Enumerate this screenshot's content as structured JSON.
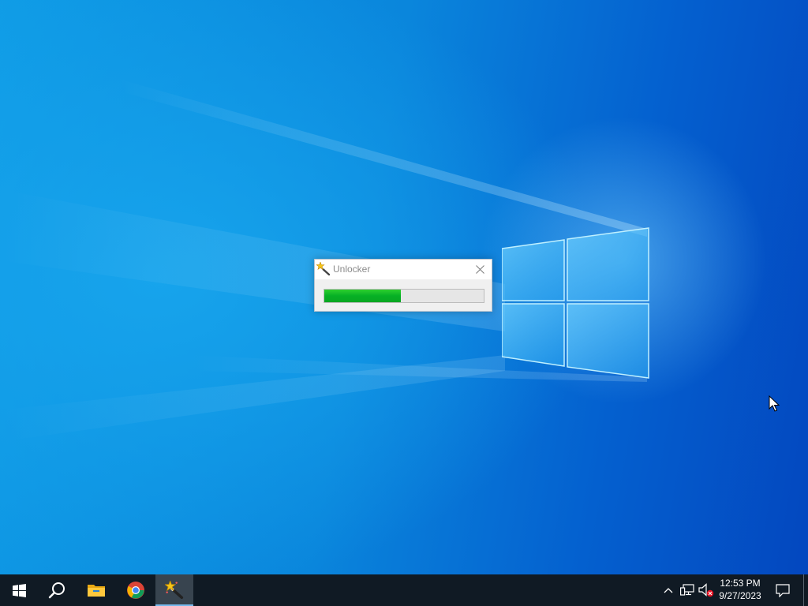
{
  "dialog": {
    "title": "Unlocker",
    "progress_fraction": 0.48,
    "icon": "magic-wand-icon",
    "close_icon": "close-icon"
  },
  "taskbar": {
    "items": [
      {
        "name": "start-button",
        "icon": "windows-start-icon"
      },
      {
        "name": "search-button",
        "icon": "search-icon"
      },
      {
        "name": "file-explorer-button",
        "icon": "folder-icon"
      },
      {
        "name": "chrome-button",
        "icon": "chrome-icon"
      },
      {
        "name": "unlocker-taskbar-button",
        "icon": "magic-wand-icon",
        "active": true
      }
    ],
    "tray": {
      "icons": [
        "chevron-up-icon",
        "network-icon",
        "volume-muted-icon"
      ],
      "time": "12:53 PM",
      "date": "9/27/2023",
      "notification_icon": "notification-icon"
    }
  },
  "colors": {
    "progress_fill": "#06b025",
    "taskbar_bg": "#101a24",
    "active_indicator": "#76b9ed"
  }
}
